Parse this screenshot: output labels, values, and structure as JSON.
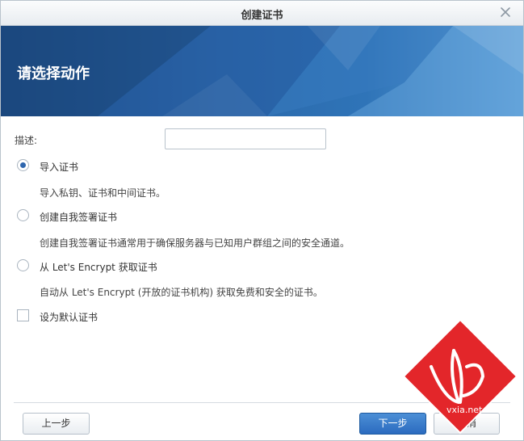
{
  "window": {
    "title": "创建证书"
  },
  "banner": {
    "heading": "请选择动作"
  },
  "form": {
    "description_label": "描述:",
    "description_value": "",
    "options": [
      {
        "label": "导入证书",
        "desc": "导入私钥、证书和中间证书。",
        "checked": true
      },
      {
        "label": "创建自我签署证书",
        "desc": "创建自我签署证书通常用于确保服务器与已知用户群组之间的安全通道。",
        "checked": false
      },
      {
        "label": "从 Let's Encrypt 获取证书",
        "desc": "自动从 Let's Encrypt (开放的证书机构) 获取免费和安全的证书。",
        "checked": false
      }
    ],
    "default_checkbox_label": "设为默认证书"
  },
  "buttons": {
    "prev": "上一步",
    "next": "下一步",
    "cancel": "取消"
  },
  "watermark": {
    "text": "vxia.net"
  },
  "colors": {
    "accent": "#2d65ad",
    "banner": "#2a67a8",
    "watermark": "#e3262a"
  },
  "icons": {
    "close": "close-icon"
  }
}
